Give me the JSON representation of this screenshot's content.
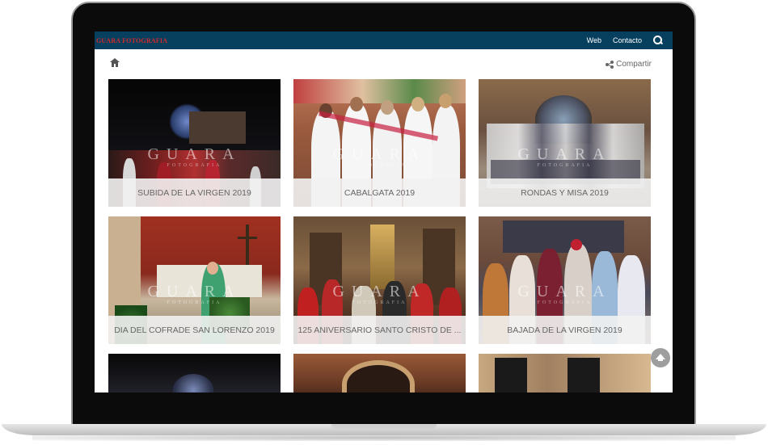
{
  "site": {
    "brand": "GUARA FOTOGRAFIA",
    "nav": [
      "Web",
      "Contacto"
    ],
    "share_label": "Compartir"
  },
  "watermark": {
    "main": "GUARA",
    "sub": "FOTOGRAFIA"
  },
  "albums": [
    {
      "title": "SUBIDA DE LA VIRGEN 2019"
    },
    {
      "title": "CABALGATA 2019"
    },
    {
      "title": "RONDAS Y MISA 2019"
    },
    {
      "title": "DIA DEL COFRADE SAN LORENZO 2019"
    },
    {
      "title": "125 ANIVERSARIO SANTO CRISTO DE ..."
    },
    {
      "title": "BAJADA DE LA VIRGEN 2019"
    }
  ],
  "colors": {
    "topbar": "#073f5e",
    "brand": "#d42a2a"
  }
}
